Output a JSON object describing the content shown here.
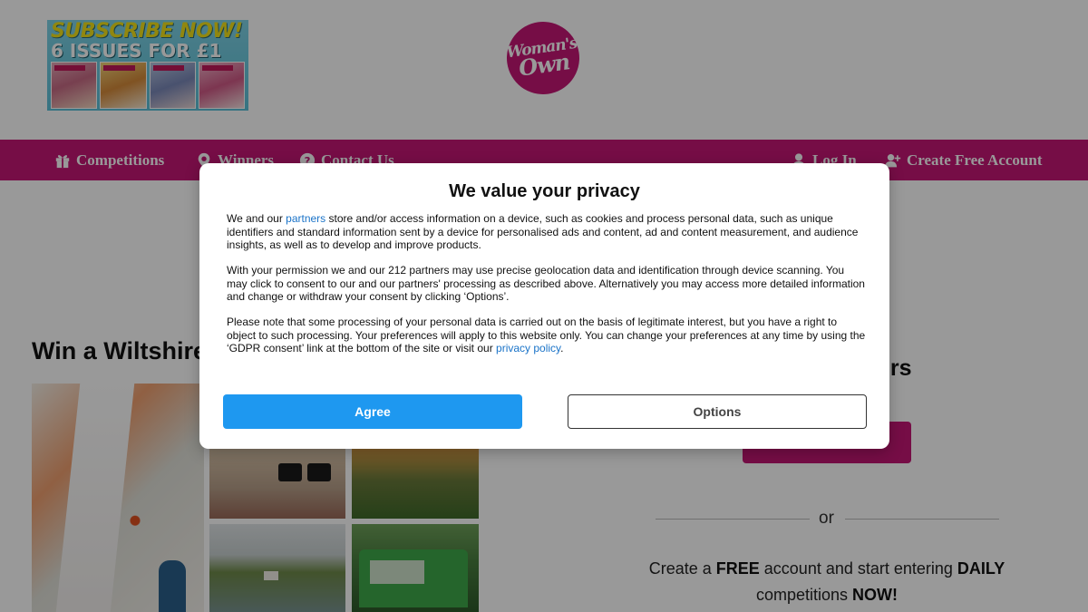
{
  "promo": {
    "line1": "SUBSCRIBE NOW!",
    "line2": "6 ISSUES FOR £1"
  },
  "logo": {
    "line1": "Woman's",
    "line2": "Own"
  },
  "nav": {
    "left": [
      {
        "label": "Competitions",
        "icon": "gift-icon"
      },
      {
        "label": "Winners",
        "icon": "map-pin-icon"
      },
      {
        "label": "Contact Us",
        "icon": "question-icon"
      }
    ],
    "right": [
      {
        "label": "Log In",
        "icon": "user-icon"
      },
      {
        "label": "Create Free Account",
        "icon": "user-plus-icon"
      }
    ]
  },
  "colors": {
    "brand": "#c51675",
    "agree_button": "#1e98f0",
    "link": "#1a73c8"
  },
  "main": {
    "competition_title": "Win a Wiltshire",
    "right_heading": "ers",
    "or_text": "or",
    "create_account": {
      "pre": "Create a ",
      "free": "FREE",
      "mid": " account and start entering ",
      "daily": "DAILY",
      "post_pre": "competitions ",
      "now": "NOW!"
    }
  },
  "consent": {
    "title": "We value your privacy",
    "p1_before": "We and our ",
    "p1_link": "partners",
    "p1_after": " store and/or access information on a device, such as cookies and process personal data, such as unique identifiers and standard information sent by a device for personalised ads and content, ad and content measurement, and audience insights, as well as to develop and improve products.",
    "p2": "With your permission we and our 212 partners may use precise geolocation data and identification through device scanning. You may click to consent to our and our partners' processing as described above. Alternatively you may access more detailed information and change or withdraw your consent by clicking ‘Options’.",
    "p3_before": "Please note that some processing of your personal data is carried out on the basis of legitimate interest, but you have a right to object to such processing. Your preferences will apply to this website only. You can change your preferences at any time by using the ‘GDPR consent’ link at the bottom of the site or visit our ",
    "p3_link": "privacy policy",
    "p3_after": ".",
    "agree_label": "Agree",
    "options_label": "Options"
  }
}
